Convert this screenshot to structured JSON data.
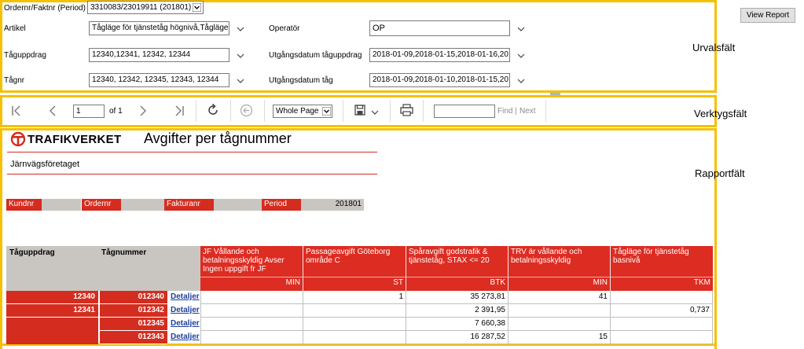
{
  "params": {
    "ordernr_label": "Ordernr/Faktnr (Period)",
    "ordernr_value": "3310083/23019911 (201801)",
    "artikel_label": "Artikel",
    "artikel_value": "Tågläge för tjänstetåg högnivå,Tågläge",
    "operator_label": "Operatör",
    "operator_value": "OP",
    "taguppdrag_label": "Tåguppdrag",
    "taguppdrag_value": "12340,12341, 12342, 12344",
    "utg_taguppdrag_label": "Utgångsdatum tåguppdrag",
    "utg_taguppdrag_value": "2018-01-09,2018-01-15,2018-01-16,20",
    "tagnr_label": "Tågnr",
    "tagnr_value": "12340, 12342, 12345, 12343, 12344",
    "utg_tag_label": "Utgångsdatum tåg",
    "utg_tag_value": "2018-01-09,2018-01-10,2018-01-15,20",
    "view_report_label": "View Report"
  },
  "zones": {
    "urval": "Urvalsfält",
    "verktyg": "Verktygsfält",
    "rapport": "Rapportfält"
  },
  "toolbar": {
    "page_value": "1",
    "of_label": "of 1",
    "zoom_value": "Whole Page",
    "find_label": "Find",
    "separator": "|",
    "next_label": "Next"
  },
  "report": {
    "logo_text": "TRAFIKVERKET",
    "title": "Avgifter per tågnummer",
    "subtitle": "Järnvägsföretaget",
    "kundnr_label": "Kundnr",
    "ordernr_label": "Ordernr",
    "fakturanr_label": "Fakturanr",
    "period_label": "Period",
    "period_value": "201801",
    "columns": {
      "taguppdrag": "Tåguppdrag",
      "tagnummer": "Tågnummer",
      "c1": "JF Vållande och betalningsskyldig Avser Ingen uppgift fr JF",
      "c2": "Passageavgift Göteborg område C",
      "c3": "Spåravgift  godstrafik & tjänstetåg, STAX  <= 20",
      "c4": "TRV är vållande och betalningsskyldig",
      "c5": "Tågläge för tjänstetåg basnivå"
    },
    "units": {
      "c1": "MIN",
      "c2": "ST",
      "c3": "BTK",
      "c4": "MIN",
      "c5": "TKM"
    },
    "rows": [
      {
        "uppdrag": "12340",
        "tagnr": "012340",
        "link": "Detaljer",
        "c1": "",
        "c2": "1",
        "c3": "35 273,81",
        "c4": "41",
        "c5": ""
      },
      {
        "uppdrag": "12341",
        "tagnr": "012342",
        "link": "Detaljer",
        "c1": "",
        "c2": "",
        "c3": "2 391,95",
        "c4": "",
        "c5": "0,737"
      },
      {
        "uppdrag": "",
        "tagnr": "012345",
        "link": "Detaljer",
        "c1": "",
        "c2": "",
        "c3": "7 660,38",
        "c4": "",
        "c5": ""
      },
      {
        "uppdrag": "",
        "tagnr": "012343",
        "link": "Detaljer",
        "c1": "",
        "c2": "",
        "c3": "16 287,52",
        "c4": "15",
        "c5": ""
      }
    ]
  }
}
